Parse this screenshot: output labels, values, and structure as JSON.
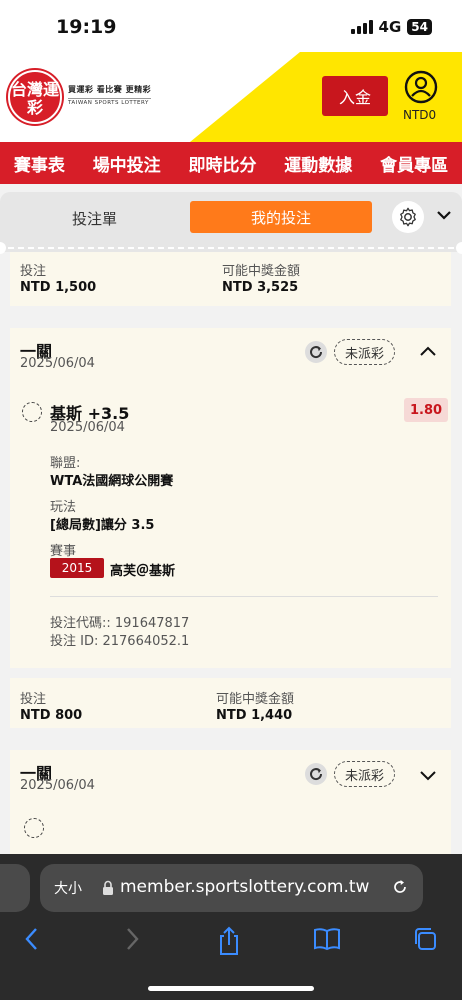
{
  "status_bar": {
    "time": "19:19",
    "network": "4G",
    "battery": "54"
  },
  "header": {
    "logo_mark": "台灣運彩",
    "logo_tagline": "買運彩 看比賽 更精彩",
    "logo_english": "TAIWAN SPORTS LOTTERY",
    "deposit_label": "入金",
    "balance": "NTD0"
  },
  "nav": {
    "items": [
      "賽事表",
      "場中投注",
      "即時比分",
      "運動數據",
      "會員專區"
    ]
  },
  "tabs": {
    "betslip": "投注單",
    "my_bets": "我的投注"
  },
  "summary_prev": {
    "stake_label": "投注",
    "stake": "NTD 1,500",
    "payout_label": "可能中獎金額",
    "payout": "NTD 3,525"
  },
  "bet1": {
    "type": "一關",
    "date": "2025/06/04",
    "status": "未派彩",
    "selection": "基斯 +3.5",
    "selection_date": "2025/06/04",
    "odds": "1.80",
    "league_label": "聯盟:",
    "league": "WTA法國網球公開賽",
    "market_label": "玩法",
    "market": "[總局數]讓分 3.5",
    "event_label": "賽事",
    "event_code": "2015",
    "event": "高芙＠基斯",
    "bet_code": "投注代碼:: 191647817",
    "bet_id": "投注 ID: 217664052.1",
    "stake_label": "投注",
    "stake": "NTD 800",
    "payout_label": "可能中獎金額",
    "payout": "NTD 1,440"
  },
  "bet2": {
    "type": "一關",
    "date": "2025/06/04",
    "status": "未派彩"
  },
  "browser": {
    "text_size": "大小",
    "url": "member.sportslottery.com.tw"
  },
  "icons": [
    "signal-icon",
    "battery-icon",
    "user-icon",
    "gear-icon",
    "chevron-down-icon",
    "refresh-icon",
    "chevron-up-icon",
    "lock-icon",
    "reload-icon",
    "back-icon",
    "forward-icon",
    "share-icon",
    "bookmarks-icon",
    "tabs-icon"
  ],
  "colors": {
    "brand_red": "#d71e28",
    "accent_orange": "#ff7a1a",
    "brand_yellow": "#ffe600",
    "card_bg": "#fbf8ec"
  }
}
